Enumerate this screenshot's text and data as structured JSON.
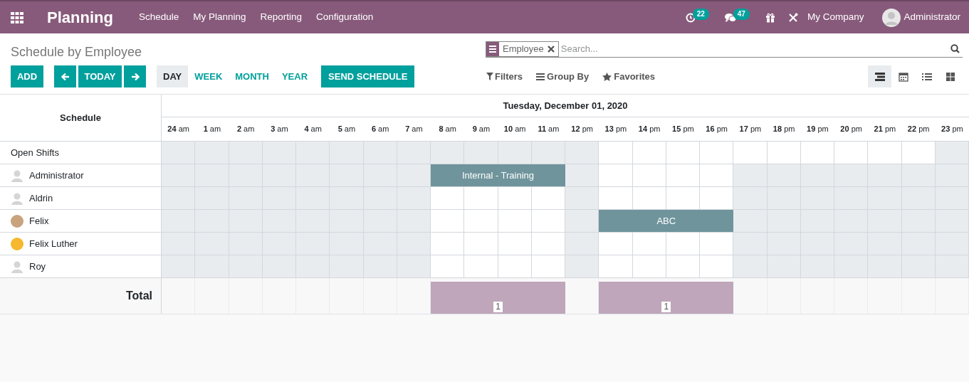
{
  "navbar": {
    "app_title": "Planning",
    "menu": [
      "Schedule",
      "My Planning",
      "Reporting",
      "Configuration"
    ],
    "activity_count": "22",
    "message_count": "47",
    "company": "My Company",
    "user": "Administrator"
  },
  "control_panel": {
    "title": "Schedule by Employee",
    "search": {
      "facet": "Employee",
      "placeholder": "Search..."
    },
    "buttons": {
      "add": "ADD",
      "today": "TODAY",
      "send": "SEND SCHEDULE"
    },
    "scales": [
      {
        "label": "DAY",
        "selected": true
      },
      {
        "label": "WEEK",
        "selected": false
      },
      {
        "label": "MONTH",
        "selected": false
      },
      {
        "label": "YEAR",
        "selected": false
      }
    ],
    "search_options": [
      {
        "kind": "filter",
        "label": "Filters"
      },
      {
        "kind": "group",
        "label": "Group By"
      },
      {
        "kind": "favorite",
        "label": "Favorites"
      }
    ],
    "views": [
      {
        "kind": "gantt",
        "selected": true
      },
      {
        "kind": "calendar",
        "selected": false
      },
      {
        "kind": "list",
        "selected": false
      },
      {
        "kind": "kanban",
        "selected": false
      }
    ]
  },
  "gantt": {
    "row_header": "Schedule",
    "date": "Tuesday, December 01, 2020",
    "hours": [
      "**24** am",
      "**1** am",
      "**2** am",
      "**3** am",
      "**4** am",
      "**5** am",
      "**6** am",
      "**7** am",
      "**8** am",
      "**9** am",
      "**10** am",
      "**11** am",
      "**12** pm",
      "**13** pm",
      "**14** pm",
      "**15** pm",
      "**16** pm",
      "**17** pm",
      "**18** pm",
      "**19** pm",
      "**20** pm",
      "**21** pm",
      "**22** pm",
      "**23** pm"
    ],
    "rows": [
      {
        "name": "Open Shifts",
        "avatar": {
          "kind": "none"
        },
        "cells": [
          {
            "kind": "off"
          },
          {
            "kind": "off"
          },
          {
            "kind": "off"
          },
          {
            "kind": "off"
          },
          {
            "kind": "off"
          },
          {
            "kind": "off"
          },
          {
            "kind": "off"
          },
          {
            "kind": "off"
          },
          {
            "kind": "off"
          },
          {
            "kind": "off"
          },
          {
            "kind": "off"
          },
          {
            "kind": "off"
          },
          {
            "kind": "off"
          },
          {
            "kind": "free"
          },
          {
            "kind": "free"
          },
          {
            "kind": "free"
          },
          {
            "kind": "free"
          },
          {
            "kind": "free"
          },
          {
            "kind": "free"
          },
          {
            "kind": "free"
          },
          {
            "kind": "free"
          },
          {
            "kind": "free"
          },
          {
            "kind": "free"
          },
          {
            "kind": "off"
          }
        ]
      },
      {
        "name": "Administrator",
        "avatar": {
          "kind": "default"
        },
        "cells": [
          {
            "kind": "off"
          },
          {
            "kind": "off"
          },
          {
            "kind": "off"
          },
          {
            "kind": "off"
          },
          {
            "kind": "off"
          },
          {
            "kind": "off"
          },
          {
            "kind": "off"
          },
          {
            "kind": "off"
          },
          {
            "kind": "shift",
            "label": "Internal - Training"
          },
          {
            "kind": "shift"
          },
          {
            "kind": "shift"
          },
          {
            "kind": "shift"
          },
          {
            "kind": "off"
          },
          {
            "kind": "free"
          },
          {
            "kind": "free"
          },
          {
            "kind": "free"
          },
          {
            "kind": "free"
          },
          {
            "kind": "off"
          },
          {
            "kind": "off"
          },
          {
            "kind": "off"
          },
          {
            "kind": "off"
          },
          {
            "kind": "off"
          },
          {
            "kind": "off"
          },
          {
            "kind": "off"
          }
        ]
      },
      {
        "name": "Aldrin",
        "avatar": {
          "kind": "default"
        },
        "cells": [
          {
            "kind": "off"
          },
          {
            "kind": "off"
          },
          {
            "kind": "off"
          },
          {
            "kind": "off"
          },
          {
            "kind": "off"
          },
          {
            "kind": "off"
          },
          {
            "kind": "off"
          },
          {
            "kind": "off"
          },
          {
            "kind": "free"
          },
          {
            "kind": "free"
          },
          {
            "kind": "free"
          },
          {
            "kind": "free"
          },
          {
            "kind": "off"
          },
          {
            "kind": "free"
          },
          {
            "kind": "free"
          },
          {
            "kind": "free"
          },
          {
            "kind": "free"
          },
          {
            "kind": "off"
          },
          {
            "kind": "off"
          },
          {
            "kind": "off"
          },
          {
            "kind": "off"
          },
          {
            "kind": "off"
          },
          {
            "kind": "off"
          },
          {
            "kind": "off"
          }
        ]
      },
      {
        "name": "Felix",
        "avatar": {
          "kind": "photo",
          "color": "#c9a27e"
        },
        "cells": [
          {
            "kind": "off"
          },
          {
            "kind": "off"
          },
          {
            "kind": "off"
          },
          {
            "kind": "off"
          },
          {
            "kind": "off"
          },
          {
            "kind": "off"
          },
          {
            "kind": "off"
          },
          {
            "kind": "off"
          },
          {
            "kind": "free"
          },
          {
            "kind": "free"
          },
          {
            "kind": "free"
          },
          {
            "kind": "free"
          },
          {
            "kind": "off"
          },
          {
            "kind": "shift",
            "label": "ABC"
          },
          {
            "kind": "shift"
          },
          {
            "kind": "shift"
          },
          {
            "kind": "shift"
          },
          {
            "kind": "off"
          },
          {
            "kind": "off"
          },
          {
            "kind": "off"
          },
          {
            "kind": "off"
          },
          {
            "kind": "off"
          },
          {
            "kind": "off"
          },
          {
            "kind": "off"
          }
        ]
      },
      {
        "name": "Felix Luther",
        "avatar": {
          "kind": "photo",
          "color": "#f5b82e"
        },
        "cells": [
          {
            "kind": "off"
          },
          {
            "kind": "off"
          },
          {
            "kind": "off"
          },
          {
            "kind": "off"
          },
          {
            "kind": "off"
          },
          {
            "kind": "off"
          },
          {
            "kind": "off"
          },
          {
            "kind": "off"
          },
          {
            "kind": "free"
          },
          {
            "kind": "free"
          },
          {
            "kind": "free"
          },
          {
            "kind": "free"
          },
          {
            "kind": "off"
          },
          {
            "kind": "free"
          },
          {
            "kind": "free"
          },
          {
            "kind": "free"
          },
          {
            "kind": "free"
          },
          {
            "kind": "off"
          },
          {
            "kind": "off"
          },
          {
            "kind": "off"
          },
          {
            "kind": "off"
          },
          {
            "kind": "off"
          },
          {
            "kind": "off"
          },
          {
            "kind": "off"
          }
        ]
      },
      {
        "name": "Roy",
        "avatar": {
          "kind": "default"
        },
        "cells": [
          {
            "kind": "off"
          },
          {
            "kind": "off"
          },
          {
            "kind": "off"
          },
          {
            "kind": "off"
          },
          {
            "kind": "off"
          },
          {
            "kind": "off"
          },
          {
            "kind": "off"
          },
          {
            "kind": "off"
          },
          {
            "kind": "free"
          },
          {
            "kind": "free"
          },
          {
            "kind": "free"
          },
          {
            "kind": "free"
          },
          {
            "kind": "off"
          },
          {
            "kind": "free"
          },
          {
            "kind": "free"
          },
          {
            "kind": "free"
          },
          {
            "kind": "free"
          },
          {
            "kind": "off"
          },
          {
            "kind": "off"
          },
          {
            "kind": "off"
          },
          {
            "kind": "off"
          },
          {
            "kind": "off"
          },
          {
            "kind": "off"
          },
          {
            "kind": "off"
          }
        ]
      }
    ],
    "total": {
      "label": "Total",
      "cells": [
        {
          "kind": "empty"
        },
        {
          "kind": "empty"
        },
        {
          "kind": "empty"
        },
        {
          "kind": "empty"
        },
        {
          "kind": "empty"
        },
        {
          "kind": "empty"
        },
        {
          "kind": "empty"
        },
        {
          "kind": "empty"
        },
        {
          "kind": "busy",
          "count": "1"
        },
        {
          "kind": "busy"
        },
        {
          "kind": "busy"
        },
        {
          "kind": "busy"
        },
        {
          "kind": "empty"
        },
        {
          "kind": "busy",
          "count": "1"
        },
        {
          "kind": "busy"
        },
        {
          "kind": "busy"
        },
        {
          "kind": "busy"
        },
        {
          "kind": "empty"
        },
        {
          "kind": "empty"
        },
        {
          "kind": "empty"
        },
        {
          "kind": "empty"
        },
        {
          "kind": "empty"
        },
        {
          "kind": "empty"
        },
        {
          "kind": "empty"
        }
      ]
    }
  }
}
